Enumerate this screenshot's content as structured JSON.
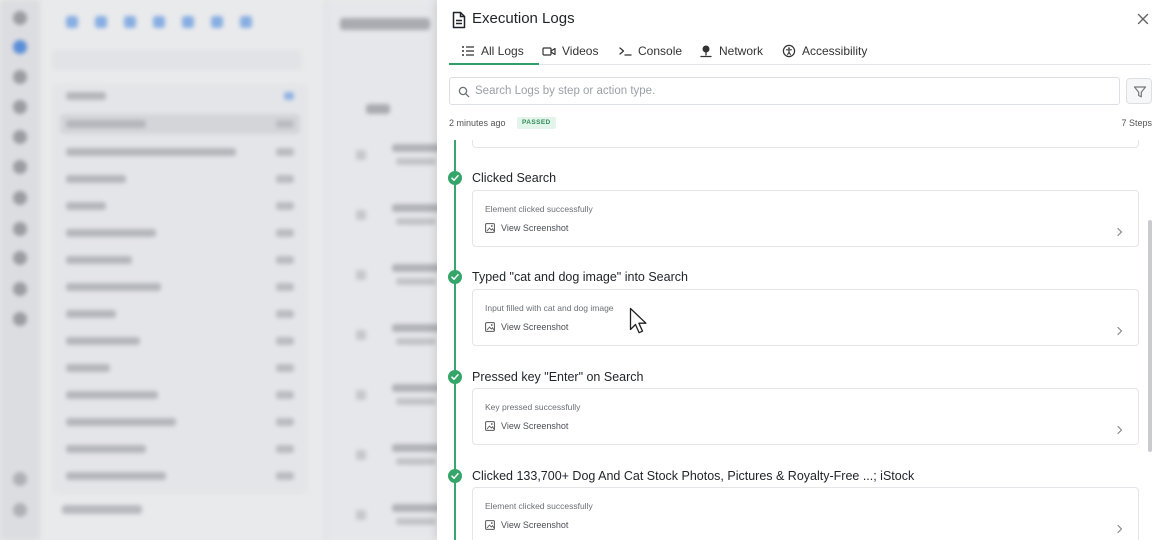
{
  "drawer": {
    "title": "Execution Logs",
    "tabs": [
      {
        "label": "All Logs",
        "icon": "list-icon",
        "active": true
      },
      {
        "label": "Videos",
        "icon": "video-icon"
      },
      {
        "label": "Console",
        "icon": "terminal-icon"
      },
      {
        "label": "Network",
        "icon": "network-icon"
      },
      {
        "label": "Accessibility",
        "icon": "accessibility-icon"
      }
    ],
    "search": {
      "placeholder": "Search Logs by step or action type.",
      "value": ""
    },
    "meta": {
      "time_ago": "2 minutes ago",
      "status": "PASSED",
      "steps": "7 Steps"
    },
    "steps": [
      {
        "title": "Clicked Search",
        "message": "Element clicked successfully",
        "screenshot_label": "View Screenshot"
      },
      {
        "title": "Typed \"cat and dog image\" into Search",
        "message": "Input filled with cat and dog image",
        "screenshot_label": "View Screenshot"
      },
      {
        "title": "Pressed key \"Enter\" on Search",
        "message": "Key pressed successfully",
        "screenshot_label": "View Screenshot"
      },
      {
        "title": "Clicked 133,700+ Dog And Cat Stock Photos, Pictures & Royalty-Free ...; iStock",
        "message": "Element clicked successfully",
        "screenshot_label": "View Screenshot"
      }
    ]
  },
  "colors": {
    "accent_green": "#35a56a",
    "badge_bg": "#e3f4ea",
    "badge_text": "#2e8b57",
    "border": "#e3e5e8"
  }
}
